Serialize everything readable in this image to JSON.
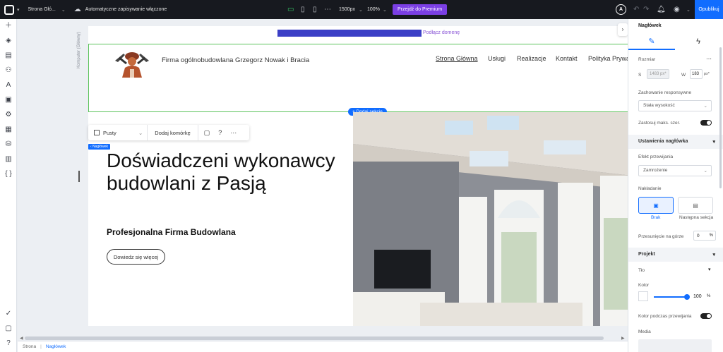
{
  "topbar": {
    "site_name": "Strona Głó...",
    "autosave": "Automatyczne zapisywanie włączone",
    "resolution": "1500px",
    "zoom": "100%",
    "premium_label": "Przejdź do Premium",
    "avatar_letter": "A",
    "publish_label": "Opublikuj"
  },
  "page": {
    "domain_link": "Podłącz domenę",
    "side_label": "Komputer (Główny)",
    "company_name": "Firma ogólnobudowlana Grzegorz Nowak i Bracia",
    "nav": [
      "Strona Główna",
      "Usługi",
      "Realizacje",
      "Kontakt",
      "Polityka Prywa"
    ],
    "add_section": "+ Dodaj sekcję",
    "toolbar": {
      "empty_label": "Pusty",
      "add_cell": "Dodaj komórkę"
    },
    "tag_label": "‹ Nagłówek",
    "hero_title": "Doświadczeni wykonawcy budowlani z Pasją",
    "hero_subtitle": "Profesjonalna Firma Budowlana",
    "cta_label": "Dowiedz się więcej"
  },
  "panel": {
    "title": "Nagłówek",
    "size_label": "Rozmiar",
    "width_letter": "S",
    "width_value": "1483 px*",
    "height_letter": "W",
    "height_value": "183",
    "height_unit": "px*",
    "responsive_label": "Zachowanie responsywne",
    "responsive_value": "Stała wysokość",
    "max_width_label": "Zastosuj maks. szer.",
    "header_settings": "Ustawienia nagłówka",
    "scroll_effect_label": "Efekt przewijania",
    "scroll_effect_value": "Zamrożenie",
    "overlay_label": "Nakładanie",
    "overlay_none": "Brak",
    "overlay_next": "Następna sekcja",
    "offset_label": "Przesunięcie na górze",
    "offset_value": "0",
    "offset_unit": "%",
    "design_label": "Projekt",
    "background_label": "Tło",
    "color_label": "Kolor",
    "opacity_value": "100",
    "opacity_unit": "%",
    "scroll_color_label": "Kolor podczas przewijania",
    "media_label": "Media"
  },
  "breadcrumb": {
    "root": "Strona",
    "current": "Nagłówek"
  },
  "colors": {
    "accent": "#116dff",
    "premium": "#7b3fe4",
    "selection": "#5bc35b"
  }
}
